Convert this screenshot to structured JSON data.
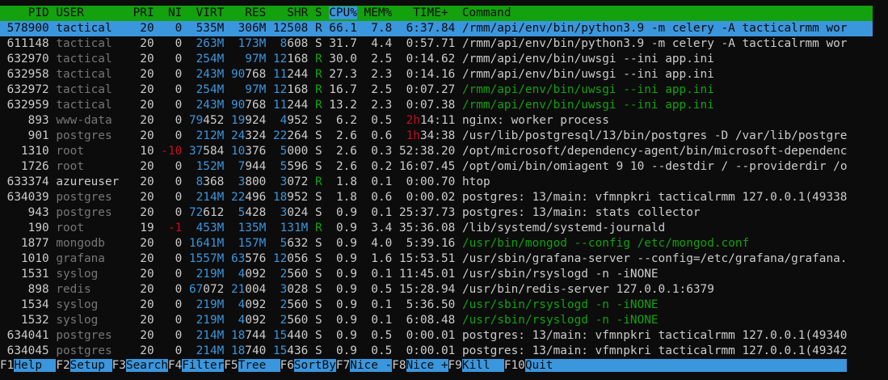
{
  "header": {
    "pid": "    PID",
    "user": " USER     ",
    "pri": "  PRI",
    "ni": "  NI",
    "virt": "  VIRT",
    "res": "   RES",
    "shr": "   SHR",
    "s": " S ",
    "cpu": "CPU%",
    "mem": " MEM%",
    "time": "   TIME+ ",
    "command": " Command"
  },
  "colors": {
    "header_bg": "#13a10e",
    "selected_bg": "#3a96dd",
    "blue": "#3a96dd",
    "green": "#13a10e",
    "red": "#c50f1f",
    "dim": "#767676"
  },
  "processes": [
    {
      "pid": "578900",
      "user": "tactical",
      "pri": "20",
      "ni": "0",
      "virt": "535M",
      "res": "306M",
      "shr": "12508",
      "s": "R",
      "cpu": "66.1",
      "mem": "7.8",
      "time": "6:37.84",
      "command": "/rmm/api/env/bin/python3.9 -m celery -A tacticalrmm wor"
    },
    {
      "pid": "611148",
      "user": "tactical",
      "pri": "20",
      "ni": "0",
      "virt": "263M",
      "res": "173M",
      "shr": "8608",
      "s": "S",
      "cpu": "31.7",
      "mem": "4.4",
      "time": "0:57.71",
      "command": "/rmm/api/env/bin/python3.9 -m celery -A tacticalrmm wor"
    },
    {
      "pid": "632970",
      "user": "tactical",
      "pri": "20",
      "ni": "0",
      "virt": "254M",
      "res": "97M",
      "shr": "12168",
      "s": "R",
      "cpu": "30.0",
      "mem": "2.5",
      "time": "0:14.62",
      "command": "/rmm/api/env/bin/uwsgi --ini app.ini"
    },
    {
      "pid": "632958",
      "user": "tactical",
      "pri": "20",
      "ni": "0",
      "virt": "243M",
      "res": "90768",
      "shr": "11244",
      "s": "R",
      "cpu": "27.3",
      "mem": "2.3",
      "time": "0:14.16",
      "command": "/rmm/api/env/bin/uwsgi --ini app.ini"
    },
    {
      "pid": "632972",
      "user": "tactical",
      "pri": "20",
      "ni": "0",
      "virt": "254M",
      "res": "97M",
      "shr": "12168",
      "s": "R",
      "cpu": "16.7",
      "mem": "2.5",
      "time": "0:07.27",
      "command": "/rmm/api/env/bin/uwsgi --ini app.ini"
    },
    {
      "pid": "632959",
      "user": "tactical",
      "pri": "20",
      "ni": "0",
      "virt": "243M",
      "res": "90768",
      "shr": "11244",
      "s": "R",
      "cpu": "13.2",
      "mem": "2.3",
      "time": "0:07.38",
      "command": "/rmm/api/env/bin/uwsgi --ini app.ini"
    },
    {
      "pid": "893",
      "user": "www-data",
      "pri": "20",
      "ni": "0",
      "virt": "79452",
      "res": "19924",
      "shr": "4952",
      "s": "S",
      "cpu": "6.2",
      "mem": "0.5",
      "time": "2h14:11",
      "command": "nginx: worker process"
    },
    {
      "pid": "901",
      "user": "postgres",
      "pri": "20",
      "ni": "0",
      "virt": "212M",
      "res": "24324",
      "shr": "22264",
      "s": "S",
      "cpu": "2.6",
      "mem": "0.6",
      "time": "1h34:38",
      "command": "/usr/lib/postgresql/13/bin/postgres -D /var/lib/postgre"
    },
    {
      "pid": "1310",
      "user": "root",
      "pri": "10",
      "ni": "-10",
      "virt": "37584",
      "res": "10376",
      "shr": "5000",
      "s": "S",
      "cpu": "2.6",
      "mem": "0.3",
      "time": "52:38.20",
      "command": "/opt/microsoft/dependency-agent/bin/microsoft-dependenc"
    },
    {
      "pid": "1726",
      "user": "root",
      "pri": "20",
      "ni": "0",
      "virt": "152M",
      "res": "7944",
      "shr": "5596",
      "s": "S",
      "cpu": "2.6",
      "mem": "0.2",
      "time": "16:07.45",
      "command": "/opt/omi/bin/omiagent 9 10 --destdir / --providerdir /o"
    },
    {
      "pid": "633374",
      "user": "azureuser",
      "pri": "20",
      "ni": "0",
      "virt": "8368",
      "res": "3800",
      "shr": "3072",
      "s": "R",
      "cpu": "1.8",
      "mem": "0.1",
      "time": "0:00.70",
      "command": "htop"
    },
    {
      "pid": "634039",
      "user": "postgres",
      "pri": "20",
      "ni": "0",
      "virt": "214M",
      "res": "22496",
      "shr": "18952",
      "s": "S",
      "cpu": "1.8",
      "mem": "0.6",
      "time": "0:00.02",
      "command": "postgres: 13/main: vfmnpkri tacticalrmm 127.0.0.1(49338"
    },
    {
      "pid": "943",
      "user": "postgres",
      "pri": "20",
      "ni": "0",
      "virt": "72612",
      "res": "5428",
      "shr": "3024",
      "s": "S",
      "cpu": "0.9",
      "mem": "0.1",
      "time": "25:37.73",
      "command": "postgres: 13/main: stats collector"
    },
    {
      "pid": "190",
      "user": "root",
      "pri": "19",
      "ni": "-1",
      "virt": "453M",
      "res": "135M",
      "shr": "131M",
      "s": "R",
      "cpu": "0.9",
      "mem": "3.4",
      "time": "35:36.08",
      "command": "/lib/systemd/systemd-journald"
    },
    {
      "pid": "1877",
      "user": "mongodb",
      "pri": "20",
      "ni": "0",
      "virt": "1641M",
      "res": "157M",
      "shr": "5632",
      "s": "S",
      "cpu": "0.9",
      "mem": "4.0",
      "time": "5:39.16",
      "command": "/usr/bin/mongod --config /etc/mongod.conf"
    },
    {
      "pid": "1010",
      "user": "grafana",
      "pri": "20",
      "ni": "0",
      "virt": "1557M",
      "res": "63576",
      "shr": "12056",
      "s": "S",
      "cpu": "0.9",
      "mem": "1.6",
      "time": "15:53.51",
      "command": "/usr/sbin/grafana-server --config=/etc/grafana/grafana."
    },
    {
      "pid": "1531",
      "user": "syslog",
      "pri": "20",
      "ni": "0",
      "virt": "219M",
      "res": "4092",
      "shr": "2560",
      "s": "S",
      "cpu": "0.9",
      "mem": "0.1",
      "time": "11:45.01",
      "command": "/usr/sbin/rsyslogd -n -iNONE"
    },
    {
      "pid": "898",
      "user": "redis",
      "pri": "20",
      "ni": "0",
      "virt": "67072",
      "res": "21004",
      "shr": "3028",
      "s": "S",
      "cpu": "0.9",
      "mem": "0.5",
      "time": "15:28.94",
      "command": "/usr/bin/redis-server 127.0.0.1:6379"
    },
    {
      "pid": "1534",
      "user": "syslog",
      "pri": "20",
      "ni": "0",
      "virt": "219M",
      "res": "4092",
      "shr": "2560",
      "s": "S",
      "cpu": "0.9",
      "mem": "0.1",
      "time": "5:36.50",
      "command": "/usr/sbin/rsyslogd -n -iNONE"
    },
    {
      "pid": "1532",
      "user": "syslog",
      "pri": "20",
      "ni": "0",
      "virt": "219M",
      "res": "4092",
      "shr": "2560",
      "s": "S",
      "cpu": "0.9",
      "mem": "0.1",
      "time": "6:08.48",
      "command": "/usr/sbin/rsyslogd -n -iNONE"
    },
    {
      "pid": "634041",
      "user": "postgres",
      "pri": "20",
      "ni": "0",
      "virt": "214M",
      "res": "18744",
      "shr": "15440",
      "s": "S",
      "cpu": "0.9",
      "mem": "0.5",
      "time": "0:00.01",
      "command": "postgres: 13/main: vfmnpkri tacticalrmm 127.0.0.1(49340"
    },
    {
      "pid": "634045",
      "user": "postgres",
      "pri": "20",
      "ni": "0",
      "virt": "214M",
      "res": "18740",
      "shr": "15436",
      "s": "S",
      "cpu": "0.9",
      "mem": "0.5",
      "time": "0:00.01",
      "command": "postgres: 13/main: vfmnpkri tacticalrmm 127.0.0.1(49342"
    }
  ],
  "footer": [
    {
      "key": "F1",
      "label": "Help  "
    },
    {
      "key": "F2",
      "label": "Setup "
    },
    {
      "key": "F3",
      "label": "Search"
    },
    {
      "key": "F4",
      "label": "Filter"
    },
    {
      "key": "F5",
      "label": "Tree  "
    },
    {
      "key": "F6",
      "label": "SortBy"
    },
    {
      "key": "F7",
      "label": "Nice -"
    },
    {
      "key": "F8",
      "label": "Nice +"
    },
    {
      "key": "F9",
      "label": "Kill  "
    },
    {
      "key": "F10",
      "label": "Quit  "
    }
  ]
}
